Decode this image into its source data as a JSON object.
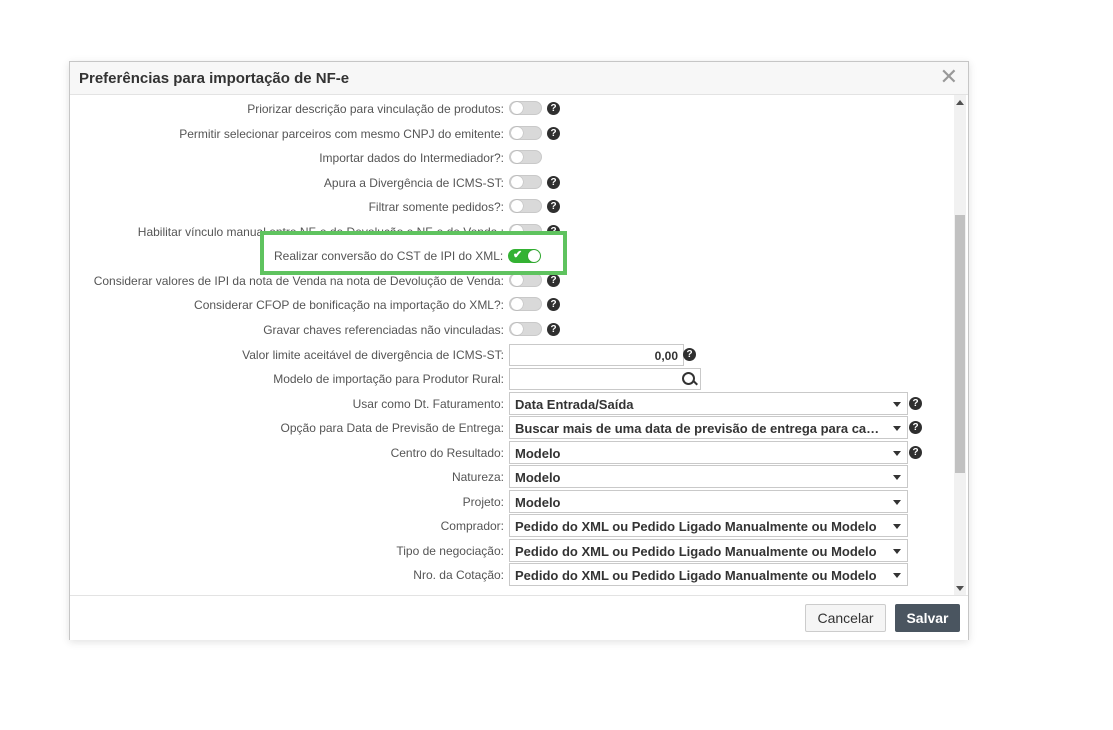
{
  "dialog": {
    "title": "Preferências para importação de NF-e",
    "close_glyph": "✕"
  },
  "rows": [
    {
      "label": "Priorizar descrição para vinculação de produtos:",
      "type": "toggle",
      "on": false,
      "help": true
    },
    {
      "label": "Permitir selecionar parceiros com mesmo CNPJ do emitente:",
      "type": "toggle",
      "on": false,
      "help": true
    },
    {
      "label": "Importar dados do Intermediador?:",
      "type": "toggle",
      "on": false,
      "help": false
    },
    {
      "label": "Apura a Divergência de ICMS-ST:",
      "type": "toggle",
      "on": false,
      "help": true
    },
    {
      "label": "Filtrar somente pedidos?:",
      "type": "toggle",
      "on": false,
      "help": true
    },
    {
      "label": "Habilitar vínculo manual entre NF-e de Devolução e NF-e de Venda :",
      "type": "toggle",
      "on": false,
      "help": true
    },
    {
      "label": "Realizar conversão do CST de IPI do XML:",
      "type": "toggle",
      "on": true,
      "help": false
    },
    {
      "label": "Considerar valores de IPI da nota de Venda na nota de Devolução de Venda:",
      "type": "toggle",
      "on": false,
      "help": true
    },
    {
      "label": "Considerar CFOP de bonificação na importação do XML?:",
      "type": "toggle",
      "on": false,
      "help": true
    },
    {
      "label": "Gravar chaves referenciadas não vinculadas:",
      "type": "toggle",
      "on": false,
      "help": true
    },
    {
      "label": "Valor limite aceitável de divergência de ICMS-ST:",
      "type": "number",
      "value": "0,00",
      "help": true
    },
    {
      "label": "Modelo de importação para Produtor Rural:",
      "type": "search",
      "value": ""
    },
    {
      "label": "Usar como Dt. Faturamento:",
      "type": "select",
      "value": "Data Entrada/Saída",
      "help": true
    },
    {
      "label": "Opção para Data de Previsão de Entrega:",
      "type": "select",
      "value": "Buscar mais de uma data de previsão de entrega para cad…",
      "help": true
    },
    {
      "label": "Centro do Resultado:",
      "type": "select",
      "value": "Modelo",
      "help": true
    },
    {
      "label": "Natureza:",
      "type": "select",
      "value": "Modelo",
      "help": false
    },
    {
      "label": "Projeto:",
      "type": "select",
      "value": "Modelo",
      "help": false
    },
    {
      "label": "Comprador:",
      "type": "select",
      "value": "Pedido do XML ou Pedido Ligado Manualmente ou Modelo",
      "help": false
    },
    {
      "label": "Tipo de negociação:",
      "type": "select",
      "value": "Pedido do XML ou Pedido Ligado Manualmente ou Modelo",
      "help": false
    },
    {
      "label": "Nro. da Cotação:",
      "type": "select",
      "value": "Pedido do XML ou Pedido Ligado Manualmente ou Modelo",
      "help": false
    }
  ],
  "highlight": {
    "label": "Realizar conversão do CST de IPI do XML:",
    "on": true
  },
  "footer": {
    "cancel_label": "Cancelar",
    "save_label": "Salvar"
  },
  "icons": {
    "help": "question-circle-icon",
    "check": "✔"
  },
  "colors": {
    "toggle_on": "#34b233",
    "highlight_border": "#5fc35f",
    "save_button": "#4a5560"
  }
}
